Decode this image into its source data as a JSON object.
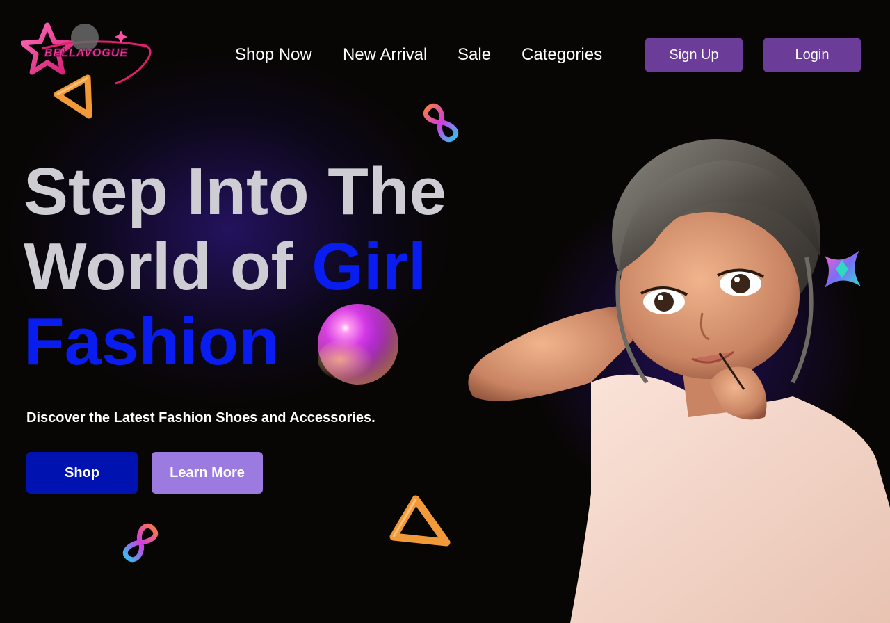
{
  "brand": {
    "logo_text": "BELLAVOGUE"
  },
  "nav": {
    "items": [
      {
        "label": "Shop Now"
      },
      {
        "label": "New Arrival"
      },
      {
        "label": "Sale"
      },
      {
        "label": "Categories"
      }
    ],
    "signup_label": "Sign Up",
    "login_label": "Login"
  },
  "hero": {
    "title_line1": "Step Into The",
    "title_line2_plain": "World of ",
    "title_line2_accent": "Girl",
    "title_line3_accent": "Fashion",
    "tagline": "Discover the Latest Fashion Shoes and Accessories.",
    "shop_label": "Shop",
    "learn_more_label": "Learn More"
  },
  "colors": {
    "background": "#080604",
    "title_text": "#cfcdd4",
    "accent_blue": "#0a1df0",
    "header_button": "#6b3d99",
    "shop_button": "#0012b0",
    "learn_more_button": "#9c7be0",
    "logo_pink": "#ff3fa4",
    "triangle_orange": "#f2993a"
  },
  "icons": {
    "logo": "star-logo-icon",
    "decorations": [
      "triangle-icon",
      "infinity-icon",
      "sparkle-cross-icon",
      "sphere-icon"
    ]
  }
}
